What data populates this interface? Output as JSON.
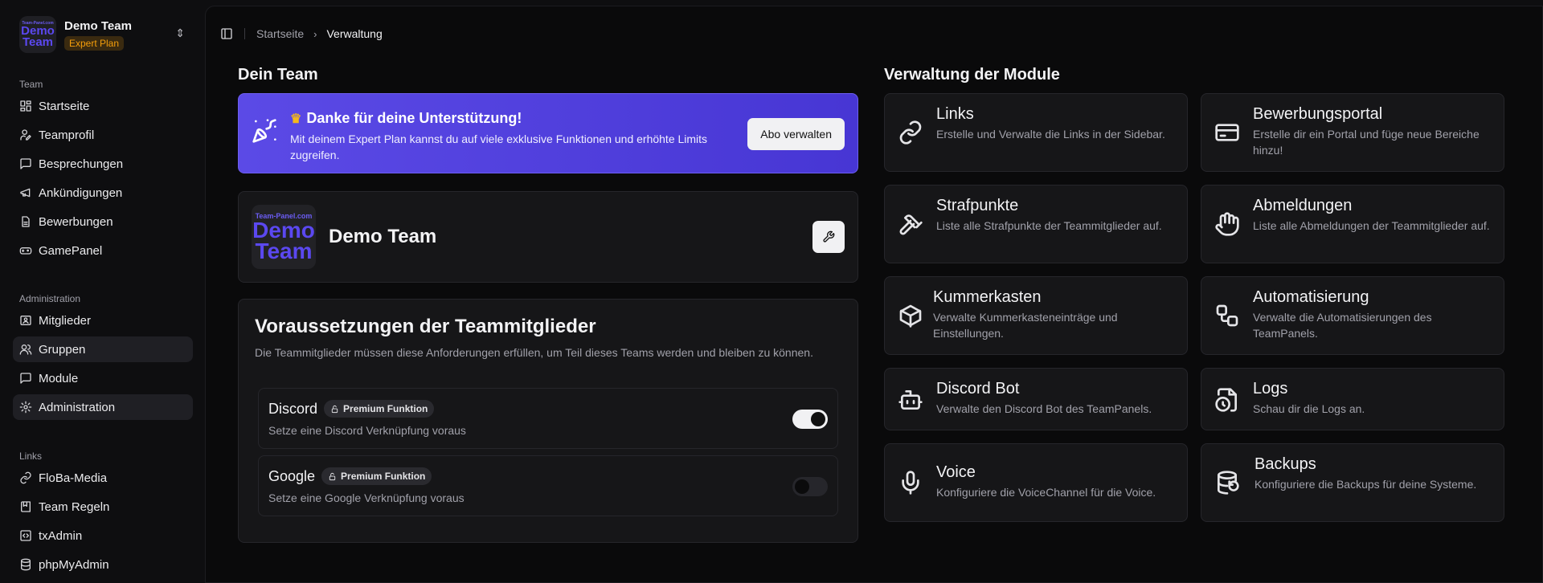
{
  "team": {
    "name": "Demo Team",
    "plan": "Expert Plan",
    "logo_small": "Team-Panel.com",
    "logo_line1": "Demo",
    "logo_line2": "Team"
  },
  "sidebar": {
    "team_heading": "Team",
    "team_items": [
      {
        "label": "Startseite",
        "icon": "grid-icon"
      },
      {
        "label": "Teamprofil",
        "icon": "user-pen-icon"
      },
      {
        "label": "Besprechungen",
        "icon": "chat-icon"
      },
      {
        "label": "Ankündigungen",
        "icon": "megaphone-icon"
      },
      {
        "label": "Bewerbungen",
        "icon": "file-icon"
      },
      {
        "label": "GamePanel",
        "icon": "gamepad-icon"
      }
    ],
    "admin_heading": "Administration",
    "admin_items": [
      {
        "label": "Mitglieder",
        "icon": "id-card-icon"
      },
      {
        "label": "Gruppen",
        "icon": "users-icon"
      },
      {
        "label": "Module",
        "icon": "chat-icon"
      },
      {
        "label": "Administration",
        "icon": "gear-icon"
      }
    ],
    "links_heading": "Links",
    "link_items": [
      {
        "label": "FloBa-Media",
        "icon": "link-icon"
      },
      {
        "label": "Team Regeln",
        "icon": "book-icon"
      },
      {
        "label": "txAdmin",
        "icon": "code-icon"
      },
      {
        "label": "phpMyAdmin",
        "icon": "database-icon"
      }
    ]
  },
  "breadcrumb": {
    "home": "Startseite",
    "current": "Verwaltung"
  },
  "left": {
    "heading": "Dein Team",
    "banner": {
      "title": "Danke für deine Unterstützung!",
      "text": "Mit deinem Expert Plan kannst du auf viele exklusive Funktionen und erhöhte Limits zugreifen.",
      "button": "Abo verwalten"
    },
    "requirements": {
      "title": "Voraussetzungen der Teammitglieder",
      "description": "Die Teammitglieder müssen diese Anforderungen erfüllen, um Teil dieses Teams werden und bleiben zu können.",
      "premium_label": "Premium Funktion",
      "items": [
        {
          "name": "Discord",
          "desc": "Setze eine Discord Verknüpfung voraus",
          "enabled": true
        },
        {
          "name": "Google",
          "desc": "Setze eine Google Verknüpfung voraus",
          "enabled": false
        }
      ]
    }
  },
  "modules": {
    "heading": "Verwaltung der Module",
    "items": [
      {
        "title": "Links",
        "desc": "Erstelle und Verwalte die Links in der Sidebar.",
        "icon": "link-icon"
      },
      {
        "title": "Bewerbungsportal",
        "desc": "Erstelle dir ein Portal und füge neue Bereiche hinzu!",
        "icon": "credit-card-icon"
      },
      {
        "title": "Strafpunkte",
        "desc": "Liste alle Strafpunkte der Teammitglieder auf.",
        "icon": "hammer-icon"
      },
      {
        "title": "Abmeldungen",
        "desc": "Liste alle Abmeldungen der Teammitglieder auf.",
        "icon": "hand-icon"
      },
      {
        "title": "Kummerkasten",
        "desc": "Verwalte Kummerkasteneinträge und Einstellungen.",
        "icon": "box-icon"
      },
      {
        "title": "Automatisierung",
        "desc": "Verwalte die Automatisierungen des TeamPanels.",
        "icon": "workflow-icon"
      },
      {
        "title": "Discord Bot",
        "desc": "Verwalte den Discord Bot des TeamPanels.",
        "icon": "bot-icon"
      },
      {
        "title": "Logs",
        "desc": "Schau dir die Logs an.",
        "icon": "file-clock-icon"
      },
      {
        "title": "Voice",
        "desc": "Konfiguriere die VoiceChannel für die Voice.",
        "icon": "mic-icon"
      },
      {
        "title": "Backups",
        "desc": "Konfiguriere die Backups für deine Systeme.",
        "icon": "database-backup-icon"
      }
    ]
  }
}
